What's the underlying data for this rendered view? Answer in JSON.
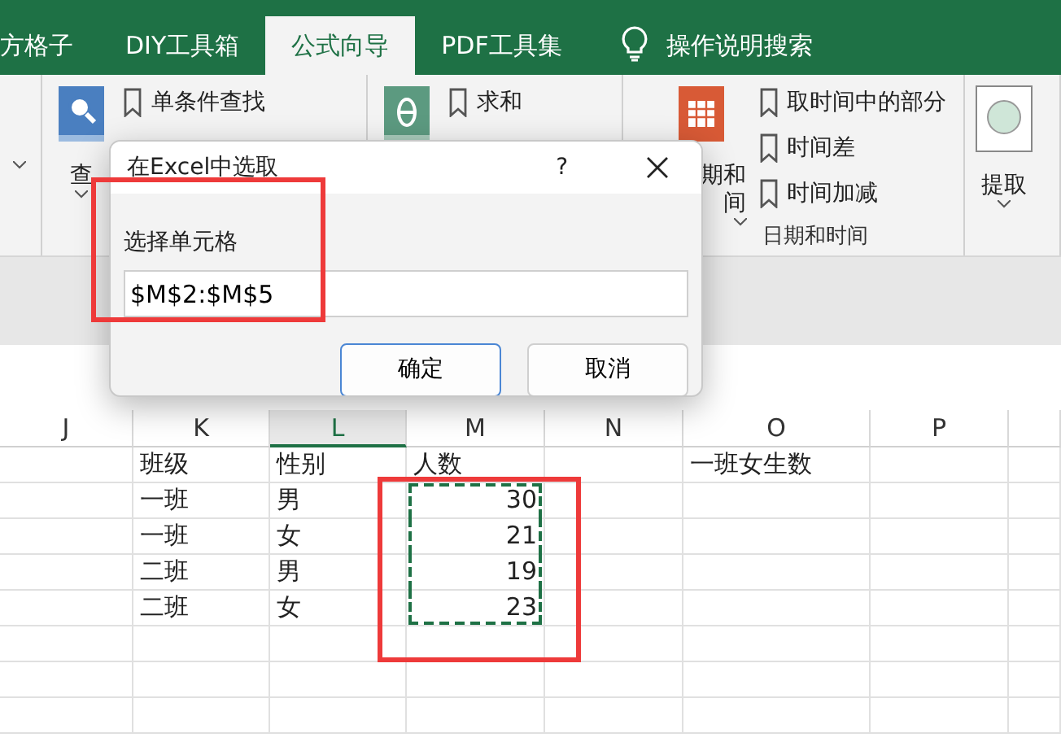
{
  "ribbon_tabs": [
    {
      "label": "方格子",
      "selected": false
    },
    {
      "label": "DIY工具箱",
      "selected": false
    },
    {
      "label": "公式向导",
      "selected": true
    },
    {
      "label": "PDF工具集",
      "selected": false
    }
  ],
  "search_tab": {
    "label": "操作说明搜索"
  },
  "ribbon_groups": [
    {
      "kind": "lookup",
      "big_label": [
        "查"
      ],
      "items": [
        "单条件查找"
      ]
    },
    {
      "kind": "math",
      "items": [
        "求和"
      ]
    },
    {
      "kind": "datetime",
      "big_label": [
        "期和",
        "间"
      ],
      "items": [
        "取时间中的部分",
        "时间差",
        "时间加减"
      ],
      "group_label": "日期和时间"
    },
    {
      "kind": "extract",
      "big_label": [
        "提取"
      ]
    }
  ],
  "sheet": {
    "columns": [
      {
        "label": "J",
        "selected": false
      },
      {
        "label": "K",
        "selected": false
      },
      {
        "label": "L",
        "selected": true
      },
      {
        "label": "M",
        "selected": false,
        "in_marquee": true
      },
      {
        "label": "N",
        "selected": false
      },
      {
        "label": "O",
        "selected": false
      },
      {
        "label": "P",
        "selected": false
      }
    ],
    "rows": [
      {
        "cells": [
          "",
          "班级",
          "性别",
          "人数",
          "",
          "一班女生数",
          ""
        ],
        "in_marquee": false
      },
      {
        "cells": [
          "",
          "一班",
          "男",
          "30",
          "",
          "",
          ""
        ],
        "in_marquee": true
      },
      {
        "cells": [
          "",
          "一班",
          "女",
          "21",
          "",
          "",
          ""
        ],
        "in_marquee": true
      },
      {
        "cells": [
          "",
          "二班",
          "男",
          "19",
          "",
          "",
          ""
        ],
        "in_marquee": true
      },
      {
        "cells": [
          "",
          "二班",
          "女",
          "23",
          "",
          "",
          ""
        ],
        "in_marquee": true
      }
    ]
  },
  "dialog": {
    "title": "在Excel中选取",
    "help": "?",
    "field_label": "选择单元格",
    "value": "$M$2:$M$5",
    "buttons": [
      {
        "label": "确定",
        "default": true
      },
      {
        "label": "取消",
        "default": false
      }
    ]
  }
}
